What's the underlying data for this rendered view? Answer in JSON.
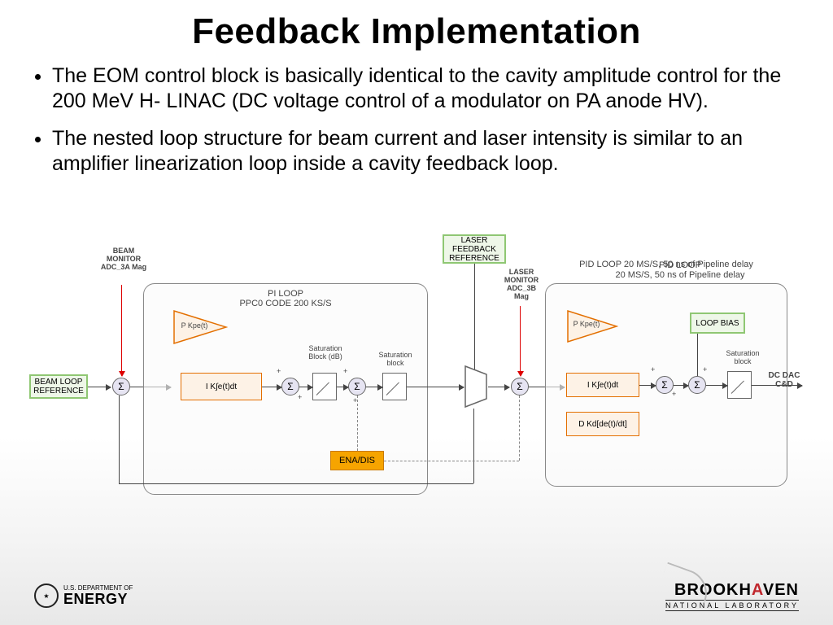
{
  "title": "Feedback Implementation",
  "bullets": [
    "The EOM control block is basically identical to the cavity amplitude control for the 200 MeV H- LINAC (DC voltage control of a modulator on PA anode HV).",
    "The nested loop structure for beam current and laser intensity is similar to an amplifier linearization loop inside a cavity feedback loop."
  ],
  "refs": {
    "beam_loop": "BEAM LOOP REFERENCE",
    "laser_fb": "LASER FEEDBACK REFERENCE",
    "loop_bias": "LOOP BIAS"
  },
  "monitors": {
    "beam": "BEAM MONITOR ADC_3A Mag",
    "laser": "LASER MONITOR ADC_3B Mag"
  },
  "loop1": {
    "title": "PI LOOP\nPPC0 CODE 200 KS/S",
    "p": "P Kpe(t)",
    "i": "I   K∫e(t)dt",
    "sat1": "Saturation Block (dB)",
    "sat2": "Saturation block",
    "ena": "ENA/DIS"
  },
  "loop2": {
    "title": "PID LOOP\n20 MS/S, 50 ns of Pipeline delay",
    "p": "P Kpe(t)",
    "i": "I   K∫e(t)dt",
    "d": "D   Kd[de(t)/dt]",
    "sat": "Saturation block",
    "out": "DC DAC C&D"
  },
  "sigma": "Σ",
  "plus": "+",
  "footer": {
    "doe_top": "U.S. DEPARTMENT OF",
    "doe_big": "ENERGY",
    "bnl1": "BROOKH",
    "bnl2": "VEN",
    "bnl_sub": "NATIONAL LABORATORY"
  }
}
